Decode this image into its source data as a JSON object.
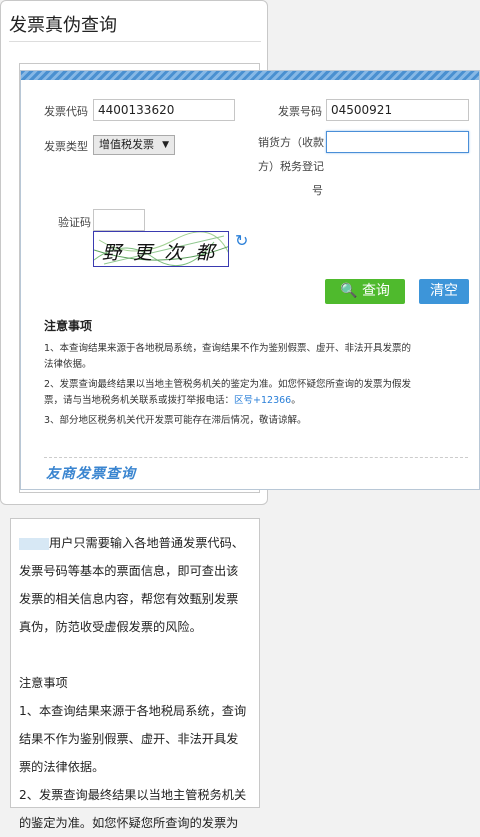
{
  "page": {
    "title": "发票真伪查询"
  },
  "form": {
    "invoice_code_label": "发票代码",
    "invoice_code_value": "4400133620",
    "invoice_number_label": "发票号码",
    "invoice_number_value": "04500921",
    "invoice_type_label": "发票类型",
    "invoice_type_value": "增值税发票",
    "seller_tax_label_1": "销货方（收款",
    "seller_tax_label_2": "方）税务登记",
    "seller_tax_label_3": "号",
    "seller_tax_value": "",
    "captcha_label": "验证码",
    "captcha_value": "",
    "captcha_image_text": "野 更 次 都",
    "query_button": "查询",
    "clear_button": "清空"
  },
  "notice": {
    "title": "注意事项",
    "items": [
      "1、本查询结果来源于各地税局系统，查询结果不作为鉴别假票、虚开、非法开具发票的",
      "法律依据。",
      "2、发票查询最终结果以当地主管税务机关的鉴定为准。如您怀疑您所查询的发票为假发",
      "票，请与当地税务机关联系或拨打举报电话：",
      "区号+12366",
      "。",
      "3、部分地区税务机关代开发票可能存在滞后情况，敬请谅解。"
    ],
    "brand": "友商发票查询"
  },
  "description": {
    "intro_lines": [
      "用户只需要输入各地普通发票代码、",
      "发票号码等基本的票面信息，即可查出该",
      "发票的相关信息内容，帮您有效甄别发票",
      "真伪，防范收受虚假发票的风险。"
    ],
    "notice_title": "注意事项",
    "notice_lines": [
      "1、本查询结果来源于各地税局系统，查询",
      "结果不作为鉴别假票、虚开、非法开具发",
      "票的法律依据。",
      "2、发票查询最终结果以当地主管税务机关",
      "的鉴定为准。如您怀疑您所查询的发票为"
    ]
  },
  "colors": {
    "accent_blue": "#3d95d9",
    "query_green": "#4fba2d",
    "link_blue": "#2a7fd8"
  }
}
